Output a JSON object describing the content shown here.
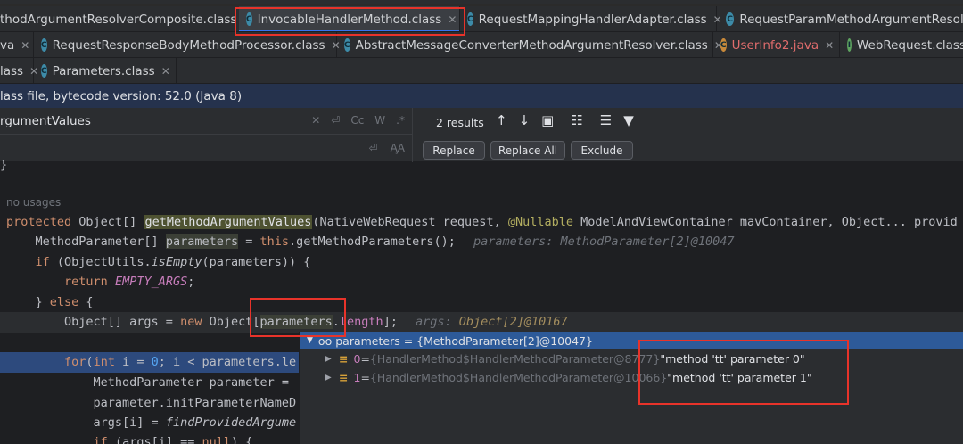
{
  "tabs": {
    "row1": [
      {
        "label": "thodArgumentResolverComposite.class",
        "type": "class"
      },
      {
        "label": "InvocableHandlerMethod.class",
        "type": "class",
        "active": true
      },
      {
        "label": "RequestMappingHandlerAdapter.class",
        "type": "class"
      },
      {
        "label": "RequestParamMethodArgumentResolve",
        "type": "class"
      }
    ],
    "row2": [
      {
        "label": "va",
        "type": "java"
      },
      {
        "label": "RequestResponseBodyMethodProcessor.class",
        "type": "class"
      },
      {
        "label": "AbstractMessageConverterMethodArgumentResolver.class",
        "type": "class"
      },
      {
        "label": "UserInfo2.java",
        "type": "java"
      },
      {
        "label": "WebRequest.class",
        "type": "iface"
      }
    ],
    "row3": [
      {
        "label": "lass",
        "type": "class"
      },
      {
        "label": "Parameters.class",
        "type": "class"
      }
    ]
  },
  "infobar": {
    "text": "lass file, bytecode version: 52.0 (Java 8)"
  },
  "find": {
    "query": "rgumentValues",
    "results": "2 results",
    "replace_btn": "Replace",
    "replace_all_btn": "Replace All",
    "exclude_btn": "Exclude",
    "opt_cc": "Cc",
    "opt_w": "W",
    "opt_regex": ".*",
    "opt_aa": "A̧A"
  },
  "code": {
    "usages": "no usages",
    "sig_kw": "protected",
    "sig_type": " Object[] ",
    "sig_fn": "getMethodArgumentValues",
    "sig_rest1": "(NativeWebRequest request, ",
    "sig_ann": "@Nullable",
    "sig_rest2": " ModelAndViewContainer mavContainer, Object... provid",
    "l2a": "    MethodParameter[] ",
    "l2b": "parameters",
    "l2c": " = ",
    "l2d": "this",
    "l2e": ".getMethodParameters();",
    "l2hint": "parameters: MethodParameter[2]@10047",
    "l3a": "    ",
    "l3b": "if",
    "l3c": " (ObjectUtils.",
    "l3d": "isEmpty",
    "l3e": "(parameters)) {",
    "l4a": "        ",
    "l4b": "return",
    "l4c": " ",
    "l4d": "EMPTY_ARGS",
    "l4e": ";",
    "l5a": "    } ",
    "l5b": "else",
    "l5c": " {",
    "l6a": "        Object[] args = ",
    "l6b": "new",
    "l6c": " Object[",
    "l6d": "parameters",
    "l6e": ".",
    "l6f": "length",
    "l6g": "];",
    "l6hint1": "args: ",
    "l6hint2": "Object[2]@10167",
    "l7a": "        ",
    "l7b": "for",
    "l7c": "(",
    "l7d": "int",
    "l7e": " i = ",
    "l7f": "0",
    "l7g": "; i < parameters.le",
    "l8": "            MethodParameter parameter = ",
    "l9": "            parameter.initParameterNameD",
    "l10a": "            args[i] = ",
    "l10b": "findProvidedArgume",
    "l11a": "            ",
    "l11b": "if",
    "l11c": " (args[i] == ",
    "l11d": "null",
    "l11e": ") {",
    "brace": "}"
  },
  "popup": {
    "header_ico": "oo",
    "header": "parameters = {MethodParameter[2]@10047}",
    "rows": [
      {
        "idx": "0",
        "eq": " = ",
        "cls": "{HandlerMethod$HandlerMethodParameter@8777}",
        "str": " \"method 'tt' parameter 0\""
      },
      {
        "idx": "1",
        "eq": " = ",
        "cls": "{HandlerMethod$HandlerMethodParameter@10066}",
        "str": " \"method 'tt' parameter 1\""
      }
    ]
  },
  "colors": {
    "highlight_box": "#e8332a",
    "accent": "#3574f0",
    "exec_line": "#2d4a7d"
  }
}
